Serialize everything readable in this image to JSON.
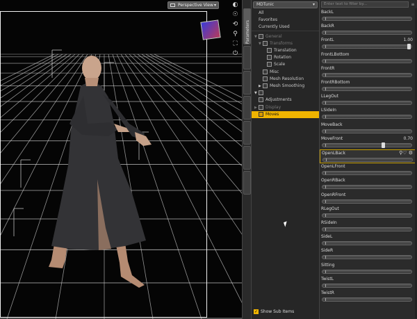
{
  "viewport": {
    "view_label": "Perspective View",
    "tools": [
      "eye-icon",
      "orbit-icon",
      "zoom-icon",
      "frame-icon",
      "reset-icon"
    ]
  },
  "side_tab": {
    "label": "Parameters"
  },
  "tree": {
    "node_selector": "MDTunic",
    "rows": [
      {
        "label": "All",
        "indent": 0,
        "toggle": "",
        "icon": false,
        "state": "normal"
      },
      {
        "label": "Favorites",
        "indent": 0,
        "toggle": "",
        "icon": false,
        "state": "normal"
      },
      {
        "label": "Currently Used",
        "indent": 0,
        "toggle": "",
        "icon": false,
        "state": "normal"
      },
      {
        "label": "General",
        "indent": 0,
        "toggle": "▼",
        "icon": true,
        "state": "dim"
      },
      {
        "label": "Transforms",
        "indent": 1,
        "toggle": "▼",
        "icon": true,
        "state": "dim"
      },
      {
        "label": "Translation",
        "indent": 2,
        "toggle": "",
        "icon": true,
        "state": "normal"
      },
      {
        "label": "Rotation",
        "indent": 2,
        "toggle": "",
        "icon": true,
        "state": "normal"
      },
      {
        "label": "Scale",
        "indent": 2,
        "toggle": "",
        "icon": true,
        "state": "normal"
      },
      {
        "label": "Misc",
        "indent": 1,
        "toggle": "",
        "icon": true,
        "state": "normal"
      },
      {
        "label": "Mesh Resolution",
        "indent": 1,
        "toggle": "",
        "icon": true,
        "state": "normal"
      },
      {
        "label": "Mesh Smoothing",
        "indent": 1,
        "toggle": "▶",
        "icon": true,
        "state": "normal"
      },
      {
        "label": "",
        "indent": 0,
        "toggle": "▼",
        "icon": true,
        "state": "normal"
      },
      {
        "label": "Adjustments",
        "indent": 0,
        "toggle": "",
        "icon": true,
        "state": "normal"
      },
      {
        "label": "Display",
        "indent": 0,
        "toggle": "▶",
        "icon": true,
        "state": "dim"
      },
      {
        "label": "Moves",
        "indent": 0,
        "toggle": "",
        "icon": true,
        "state": "sel"
      }
    ],
    "show_sub_items": "Show Sub Items"
  },
  "params": {
    "filter_placeholder": "Enter text to filter by...",
    "items": [
      {
        "label": "BackL",
        "value": "",
        "level": 0,
        "highlight": false,
        "icons": ""
      },
      {
        "label": "BackR",
        "value": "",
        "level": 0,
        "highlight": false,
        "icons": ""
      },
      {
        "label": "FrontL",
        "value": "1.00",
        "level": 1.0,
        "highlight": false,
        "icons": ""
      },
      {
        "label": "FrontLBottom",
        "value": "",
        "level": 0,
        "highlight": false,
        "icons": ""
      },
      {
        "label": "FrontR",
        "value": "",
        "level": 0,
        "highlight": false,
        "icons": ""
      },
      {
        "label": "FrontRBottom",
        "value": "",
        "level": 0,
        "highlight": false,
        "icons": ""
      },
      {
        "label": "LLegOut",
        "value": "",
        "level": 0,
        "highlight": false,
        "icons": ""
      },
      {
        "label": "LSideIn",
        "value": "",
        "level": 0,
        "highlight": false,
        "icons": ""
      },
      {
        "label": "MoveBack",
        "value": "",
        "level": 0,
        "highlight": false,
        "icons": ""
      },
      {
        "label": "MoveFront",
        "value": "0.70",
        "level": 0.7,
        "highlight": false,
        "icons": ""
      },
      {
        "label": "OpenLBack",
        "value": "",
        "level": 0,
        "highlight": true,
        "icons": "⚲♡ ⚙"
      },
      {
        "label": "OpenLFront",
        "value": "",
        "level": 0,
        "highlight": false,
        "icons": ""
      },
      {
        "label": "OpenRBack",
        "value": "",
        "level": 0,
        "highlight": false,
        "icons": ""
      },
      {
        "label": "OpenRFront",
        "value": "",
        "level": 0,
        "highlight": false,
        "icons": ""
      },
      {
        "label": "RLegOut",
        "value": "",
        "level": 0,
        "highlight": false,
        "icons": ""
      },
      {
        "label": "RSideIn",
        "value": "",
        "level": 0,
        "highlight": false,
        "icons": ""
      },
      {
        "label": "SideL",
        "value": "",
        "level": 0,
        "highlight": false,
        "icons": ""
      },
      {
        "label": "SideR",
        "value": "",
        "level": 0,
        "highlight": false,
        "icons": ""
      },
      {
        "label": "Sitting",
        "value": "",
        "level": 0,
        "highlight": false,
        "icons": ""
      },
      {
        "label": "TwistL",
        "value": "",
        "level": 0,
        "highlight": false,
        "icons": ""
      },
      {
        "label": "TwistR",
        "value": "",
        "level": 0,
        "highlight": false,
        "icons": ""
      }
    ]
  },
  "colors": {
    "accent": "#f0b400",
    "viewport_bg": "#050505",
    "panel_bg": "#2b2b2b"
  }
}
